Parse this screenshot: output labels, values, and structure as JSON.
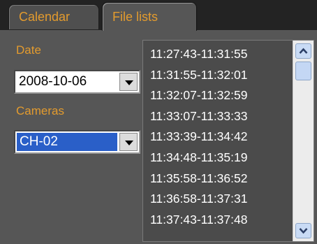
{
  "tabs": {
    "calendar": "Calendar",
    "file_lists": "File lists",
    "active": "file_lists"
  },
  "date": {
    "label": "Date",
    "value": "2008-10-06"
  },
  "cameras": {
    "label": "Cameras",
    "value": "CH-02"
  },
  "file_list": {
    "items": [
      "11:27:43-11:31:55",
      "11:31:55-11:32:01",
      "11:32:07-11:32:59",
      "11:33:07-11:33:33",
      "11:33:39-11:34:42",
      "11:34:48-11:35:19",
      "11:35:58-11:36:52",
      "11:36:58-11:37:31",
      "11:37:43-11:37:48"
    ]
  },
  "icons": {
    "combo_arrow": "chevron-down-icon",
    "scroll_up": "chevron-up-icon",
    "scroll_down": "chevron-down-icon"
  },
  "colors": {
    "accent": "#e39b2e",
    "background": "#565656",
    "selection": "#2a5fc8"
  }
}
